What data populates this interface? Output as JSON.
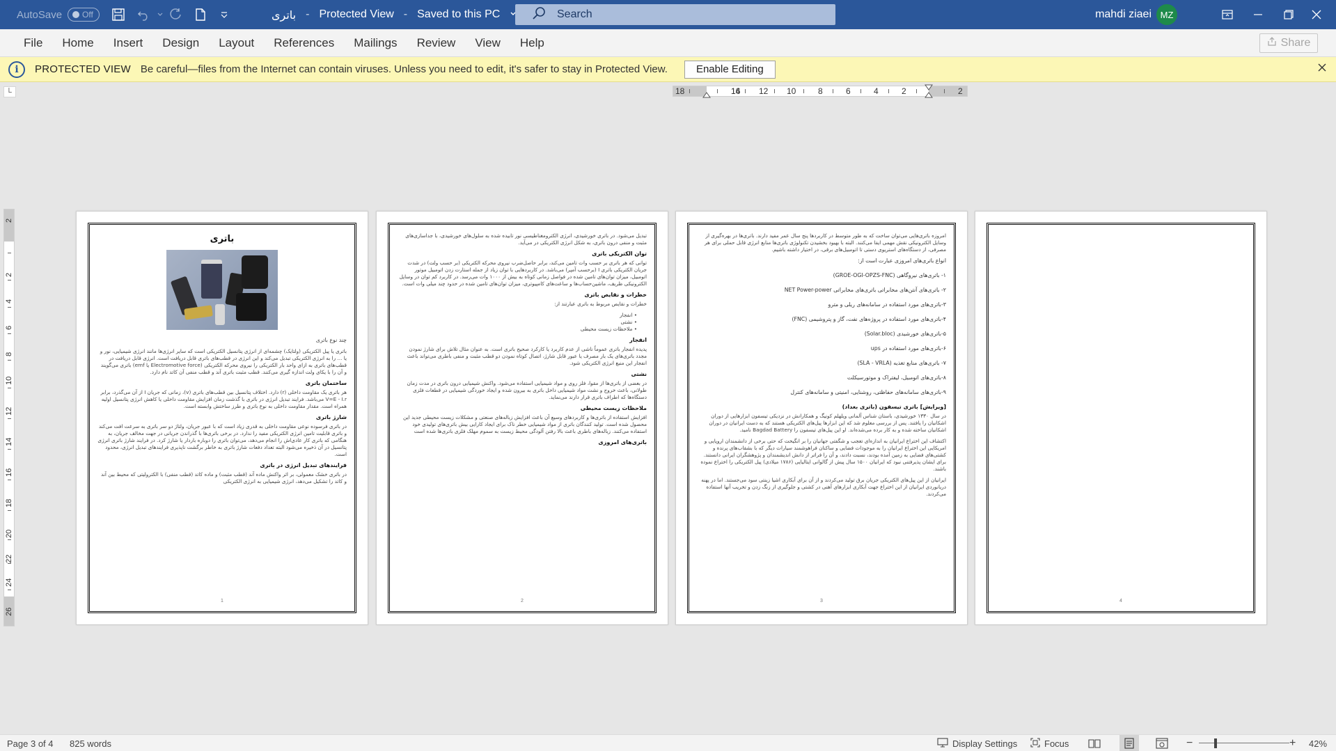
{
  "titlebar": {
    "autosave_label": "AutoSave",
    "autosave_state": "Off",
    "doc_name": "باتری",
    "view_mode": "Protected View",
    "save_status": "Saved to this PC",
    "search_placeholder": "Search",
    "user_name": "mahdi ziaei",
    "user_initials": "MZ"
  },
  "ribbon": {
    "tabs": [
      "File",
      "Home",
      "Insert",
      "Design",
      "Layout",
      "References",
      "Mailings",
      "Review",
      "View",
      "Help"
    ],
    "share_label": "Share"
  },
  "protected_view": {
    "title": "PROTECTED VIEW",
    "message": "Be careful—files from the Internet can contain viruses. Unless you need to edit, it's safer to stay in Protected View.",
    "enable_button": "Enable Editing"
  },
  "h_ruler": {
    "labels": [
      "18",
      "16",
      "14",
      "12",
      "10",
      "8",
      "6",
      "4",
      "2",
      "2"
    ]
  },
  "v_ruler": {
    "labels": [
      "2",
      "2",
      "4",
      "6",
      "8",
      "10",
      "12",
      "14",
      "16",
      "18",
      "20",
      "22",
      "24",
      "26"
    ]
  },
  "pages": [
    {
      "number": "1",
      "title": "باتری",
      "sections": [
        {
          "heading": "",
          "text": "چند نوع باتری"
        },
        {
          "heading": "",
          "text": "باتری یا پیل الکتریکی (ولتایک) چشمه‌ای از انرژی پتانسیل الکتریکی است که سایر انرژی‌ها مانند انرژی شیمیایی، نور و یا ... را به انرژی الکتریکی تبدیل می‌کند و این انرژی در قطب‌های باتری قابل دریافت است. انرژی قابل دریافت در قطب‌های باتری به ازای واحد بار الکتریکی را نیروی محرکه الکتریکی (Electromotive force یا emf) باتری می‌گویند و آن را با یکای ولت اندازه گیری می‌کنند. قطب مثبت باتری آند و قطب منفی آن کاتد نام دارد."
        },
        {
          "heading": "ساختمان باتری",
          "text": "هر باتری یک مقاومت داخلی (r) دارد. اختلاف پتانسیل بین قطب‌های باتری (v)، زمانی که جریان I از آن می‌گذرد، برابر V=E - I.r می‌باشد. فرایند تبدیل انرژی در باتری با گذشت زمان افزایش مقاومت داخلی یا کاهش انرژی پتانسیل اولیه همراه است. مقدار مقاومت داخلی به نوع باتری و طرز ساختش وابسته است."
        },
        {
          "heading": "شارژ باتری",
          "text": "در باتری فرسوده نوعی مقاومت داخلی به قدری زیاد است که با عبور جریان، ولتاژ دو سر باتری به سرعت افت می‌کند و باتری قابلیت تامین انرژی الکتریکی مفید را ندارد. در برخی باتری‌ها با گذراندن جریانی در جهت مخالف جریان، به هنگامی که باتری کار عادی‌اش را انجام می‌دهد، می‌توان باتری را دوباره باردار یا شارژ کرد. در فرایند شارژ باتری انرژی پتانسیل در آن ذخیره می‌شود البته تعداد دفعات شارژ باتری به خاطر برگشت ناپذیری فرایندهای تبدیل انرژی، محدود است."
        },
        {
          "heading": "فرایندهای تبدیل انرژی در باتری",
          "text": "در باتری خشک معمولی، بر اثر واکنش ماده آند (قطب مثبت) و ماده کاتد (قطب منفی) با الکترولیتی که محیط بین آند و کاتد را تشکیل می‌دهد، انرژی شیمیایی به انرژی الکتریکی"
        }
      ]
    },
    {
      "number": "2",
      "sections": [
        {
          "heading": "",
          "text": "تبدیل می‌شود. در باتری خورشیدی، انرژی الکترومغناطیسی نور تابیده شده به سلول‌های خورشیدی، با جداسازی‌های مثبت و منفی درون باتری، به شکل انرژی الکتریکی در می‌آید."
        },
        {
          "heading": "توان الکتریکی باتری",
          "text": "توانی که هر باتری بر حسب وات تامین می‌کند، برابر حاصل‌ضرب نیروی محرکه الکتریکی (بر حسب ولت) در شدت جریان الکتریکی باتری I (برحسب آمپر) می‌باشد. در کاربردهایی با توان زیاد از جمله استارت زدن اتومبیل موتور اتومبیل، میزان توان‌های تامین شده در فواصل زمانی کوتاه به بیش از ۱۰۰۰ وات می‌رسد. در کاربرد کم توان در وسایل الکترونیکی ظریف، ماشین‌حساب‌ها و ساعت‌های کامپیوتری، میزان توان‌های تامین شده در حدود چند میلی وات است."
        },
        {
          "heading": "خطرات و نقایص باتری",
          "text": "خطرات و نقایص مربوط به باتری عبارتند از:"
        }
      ],
      "bullets": [
        "انفجار",
        "نشتی",
        "ملاحظات زیست محیطی"
      ],
      "sections2": [
        {
          "heading": "انفجار",
          "text": "پدیده انفجار باتری عموماً ناشی از عدم کاربرد یا کارکرد صحیح باتری است. به عنوان مثال تلاش برای شارژ نمودن مجدد باتری‌های یک بار مصرف یا عبور قابل شارژ، اتصال کوتاه نمودن دو قطب مثبت و منفی باطری می‌تواند باعث انفجار این منبع انرژی الکتریکی شود."
        },
        {
          "heading": "نشتی",
          "text": "در بعضی از باتری‌ها از مقوا، فلز روی و مواد شیمیایی استفاده می‌شود. واکنش شیمیایی درون باتری در مدت زمان طولانی، باعث خروج و نشت مواد شیمیایی داخل باتری به بیرون شده و ایجاد خوردگی شیمیایی در قطعات فلزی دستگاه‌ها که اطراف باتری قرار دارند می‌نماید."
        },
        {
          "heading": "ملاحظات زیست محیطی",
          "text": "افزایش استفاده از باتری‌ها و کاربردهای وسیع آن باعث افزایش زباله‌های صنعتی و مشکلات زیست محیطی جدید این محصول شده است. تولید کنندگان باتری از مواد شیمیایی خطر ناک برای ایجاد کارایی بیش باتری‌های تولیدی خود استفاده می‌کنند. زباله‌های باطری باعث بالا رفتن آلودگی محیط زیست به سموم مهلک فلزی باتری‌ها شده است"
        },
        {
          "heading": "باتری‌های امروزی",
          "text": ""
        }
      ]
    },
    {
      "number": "3",
      "intro": "امروزه باتری‌هایی می‌توان ساخت که به طور متوسط در کاربردها پنج سال عمر مفید دارند. باتری‌ها در بهره‌گیری از وسایل الکترونیکی نقش مهمی ایفا می‌کنند. البته با بهبود بخشیدن تکنولوژی باتری‌ها منابع انرژی قابل حملی برای هر مصرفی، از دستگاه‌های استریوی دستی تا اتومبیل‌های برقی، در اختیار داشته باشیم.",
      "list_intro": "انواع باتری‌های امروزی عبارت است از:",
      "list": [
        "۱- باتری‌های نیروگاهی (GROE-OGI-OPZS-FNC)",
        "۲- باتری‌های آنتن‌های مخابراتی باتری‌های مخابراتی NET Power-power",
        "۳-باتری‌های مورد استفاده در سامانه‌های ریلی و مترو",
        "۴-باتری‌های مورد استفاده در پروژه‌های نفت، گاز و پتروشیمی (FNC)",
        "۵-باتری‌های خورشیدی (Solar.bloc)",
        "۶-باتری‌های مورد استفاده در ups",
        "۷- باتری‌های منابع تغذیه (SLA - VRLA)",
        "۸-باتری‌های اتومبیل، لیفتراک و موتورسیکلت",
        "۹-باتری‌های سامانه‌های حفاظتی، روشنایی، امنیتی و سامانه‌های کنترل"
      ],
      "sections": [
        {
          "heading": "[ویرایش] باتری تیسفون (باتری بغداد)",
          "text": "در سال ۱۳۳۰ خورشیدی، باستان شناس آلمانی ویلهلم کونیگ و همکارانش در نزدیکی تیسفون ابزارهایی از دوران اشکانیان را یافتند. پس از بررسی معلوم شد که این ابزارها پیل‌های الکتریکی هستند که به دست ایرانیان در دوران اشکانیان ساخته شده و به کار برده می‌شده‌اند. او این پیل‌های تیسفون را Bagdad Battery نامید."
        },
        {
          "heading": "",
          "text": "اکتشاف این اختراع ایرانیان به اندازه‌ای تعجب و شگفتی جهانیان را بر انگیخت که حتی برخی از دانشمندان اروپایی و امریکایی این اختراع ایرانیان را به موجودات فضایی و ساکنان فراهوشمند سیارات دیگر که با بشقاب‌های پرنده و کشتی‌های فضایی به زمین آمده بودند، نسبت دادند، و آن را فراتر از دانش اندیشمندان و پژوهشگران ایرانی دانستند. برای ایشان پذیرفتنی نبود که ایرانیان ۱۵۰۰ سال پیش از گالوانی ایتالیایی (۱۷۸۶ میلادی) پیل الکتریکی را اختراع نموده باشند."
        },
        {
          "heading": "",
          "text": "ایرانیان از این پیل‌های الکتریکی جریان برق تولید می‌کردند و از آن برای آبکاری اشیا زینتی سود می‌جستند. اما در پهنه دریانوردی ایرانیان از این اختراع جهت آبکاری ابزارهای آهنی در کشتی و جلوگیری از زنگ زدن و تخریب آنها استفاده می‌کردند."
        }
      ]
    },
    {
      "number": "4"
    }
  ],
  "statusbar": {
    "page_info": "Page 3 of 4",
    "word_count": "825 words",
    "display_settings": "Display Settings",
    "focus": "Focus",
    "zoom_minus": "−",
    "zoom_plus": "+",
    "zoom_level": "42%"
  },
  "colors": {
    "title_bar": "#2b579a",
    "protected_bar": "#fcf7b6",
    "avatar": "#1e8a4a",
    "canvas": "#e6e6e6"
  }
}
